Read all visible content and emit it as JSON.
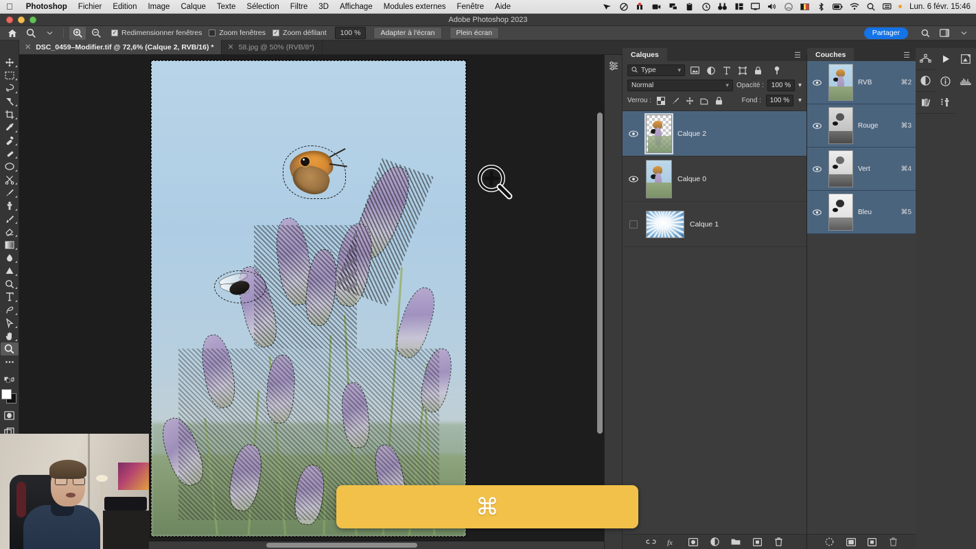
{
  "macbar": {
    "apple_icon": "apple-icon",
    "items": [
      {
        "label": "Photoshop",
        "bold": true
      },
      {
        "label": "Fichier",
        "bold": false
      },
      {
        "label": "Edition",
        "bold": false
      },
      {
        "label": "Image",
        "bold": false
      },
      {
        "label": "Calque",
        "bold": false
      },
      {
        "label": "Texte",
        "bold": false
      },
      {
        "label": "Sélection",
        "bold": false
      },
      {
        "label": "Filtre",
        "bold": false
      },
      {
        "label": "3D",
        "bold": false
      },
      {
        "label": "Affichage",
        "bold": false
      },
      {
        "label": "Modules externes",
        "bold": false
      },
      {
        "label": "Fenêtre",
        "bold": false
      },
      {
        "label": "Aide",
        "bold": false
      }
    ],
    "status_icons": [
      "airplay-icon",
      "shield-icon",
      "alarm-badge-icon",
      "screen-record-icon",
      "transfer-icon",
      "clipboard-icon",
      "clock-icon",
      "binoculars-icon",
      "columns-icon",
      "display-icon",
      "volume-icon",
      "siri-icon",
      "belgium-flag-icon",
      "bluetooth-icon",
      "battery-icon",
      "wifi-icon",
      "search-icon",
      "control-center-icon"
    ],
    "clock": "Lun. 6 févr.  15:46"
  },
  "titlebar": {
    "title": "Adobe Photoshop 2023"
  },
  "options": {
    "home_icon": "home-icon",
    "tool_icon": "zoom-tool-icon",
    "zoom_in_icon": "zoom-in-icon",
    "zoom_out_icon": "zoom-out-icon",
    "checkboxes": [
      {
        "label": "Redimensionner fenêtres",
        "checked": true
      },
      {
        "label": "Zoom fenêtres",
        "checked": false
      },
      {
        "label": "Zoom défilant",
        "checked": true
      }
    ],
    "zoom_value": "100 %",
    "fit_screen_label": "Adapter à l'écran",
    "fullscreen_label": "Plein écran",
    "share_label": "Partager",
    "search_icon": "search-icon",
    "workspace_icon": "workspace-icon",
    "chevron_icon": "chevron-down-icon"
  },
  "tabs": [
    {
      "title": "DSC_0459–Modifier.tif @ 72,6% (Calque 2, RVB/16) *",
      "active": true,
      "close_icon": "close-icon"
    },
    {
      "title": "58.jpg @ 50% (RVB/8*)",
      "active": false,
      "close_icon": "close-icon"
    }
  ],
  "toolbar": {
    "tools": [
      {
        "name": "move-tool",
        "selected": false
      },
      {
        "name": "marquee-tool",
        "selected": false
      },
      {
        "name": "lasso-tool",
        "selected": false
      },
      {
        "name": "magic-wand-tool",
        "selected": false
      },
      {
        "name": "crop-tool",
        "selected": false
      },
      {
        "name": "eyedropper-tool",
        "selected": false
      },
      {
        "name": "healing-brush-tool",
        "selected": false
      },
      {
        "name": "brush-tool",
        "selected": false
      },
      {
        "name": "clone-stamp-tool",
        "selected": false
      },
      {
        "name": "history-brush-tool",
        "selected": false
      },
      {
        "name": "eraser-tool",
        "selected": false
      },
      {
        "name": "gradient-tool",
        "selected": false
      },
      {
        "name": "blur-tool",
        "selected": false
      },
      {
        "name": "dodge-tool",
        "selected": false
      },
      {
        "name": "pen-tool",
        "selected": false
      },
      {
        "name": "type-tool",
        "selected": false
      },
      {
        "name": "path-selection-tool",
        "selected": false
      },
      {
        "name": "shape-tool",
        "selected": false
      },
      {
        "name": "hand-tool",
        "selected": false
      },
      {
        "name": "zoom-tool",
        "selected": true
      },
      {
        "name": "more-tools",
        "selected": false
      }
    ],
    "foreground_color": "#ffffff",
    "background_color": "#111111",
    "quickmask_icon": "quick-mask-icon",
    "screenmode_icon": "screen-mode-icon"
  },
  "canvas": {
    "zoom_cursor_icon": "zoom-in-cursor-icon",
    "document_image": "butterfly-on-lavender-photo",
    "selection_active": true
  },
  "layers_panel": {
    "tab_label": "Calques",
    "menu_icon": "panel-menu-icon",
    "filter_placeholder": "Type",
    "filter_icon": "search-icon",
    "filter_type_icons": [
      "image-filter-icon",
      "adjustment-filter-icon",
      "type-filter-icon",
      "shape-filter-icon",
      "smartobject-filter-icon"
    ],
    "filter_toggle_icon": "filter-toggle-icon",
    "blend_mode": "Normal",
    "opacity_label": "Opacité :",
    "opacity_value": "100 %",
    "lock_label": "Verrou :",
    "lock_icons": [
      "lock-transparency-icon",
      "lock-image-icon",
      "lock-position-icon",
      "lock-artboard-icon",
      "lock-all-icon"
    ],
    "fill_label": "Fond :",
    "fill_value": "100 %",
    "layers": [
      {
        "name": "Calque 2",
        "visible": true,
        "selected": true,
        "thumb": "butterfly-cutout-thumb"
      },
      {
        "name": "Calque 0",
        "visible": true,
        "selected": false,
        "thumb": "butterfly-photo-thumb"
      },
      {
        "name": "Calque 1",
        "visible": false,
        "selected": false,
        "thumb": "clouds-thumb"
      }
    ],
    "footer_icons": [
      "link-layers-icon",
      "layer-style-icon",
      "layer-mask-icon",
      "adjustment-layer-icon",
      "new-group-icon",
      "new-layer-icon",
      "delete-layer-icon"
    ]
  },
  "channels_panel": {
    "tab_label": "Couches",
    "menu_icon": "panel-menu-icon",
    "channels": [
      {
        "name": "RVB",
        "shortcut": "⌘2",
        "visible": true,
        "selected": true,
        "thumb": "rgb-composite-thumb"
      },
      {
        "name": "Rouge",
        "shortcut": "⌘3",
        "visible": true,
        "selected": true,
        "thumb": "red-channel-thumb"
      },
      {
        "name": "Vert",
        "shortcut": "⌘4",
        "visible": true,
        "selected": true,
        "thumb": "green-channel-thumb"
      },
      {
        "name": "Bleu",
        "shortcut": "⌘5",
        "visible": true,
        "selected": true,
        "thumb": "blue-channel-thumb"
      }
    ],
    "footer_icons": [
      "load-selection-icon",
      "save-selection-icon",
      "new-channel-icon",
      "delete-channel-icon"
    ]
  },
  "right_rail": {
    "column_a": [
      "paths-panel-icon",
      "adjustments-panel-icon",
      "libraries-panel-icon"
    ],
    "column_b": [
      "actions-panel-icon",
      "info-panel-icon",
      "clone-source-panel-icon"
    ],
    "column_c": [
      "navigator-panel-icon",
      "histogram-panel-icon"
    ]
  },
  "overlays": {
    "key_overlay_glyph": "⌘",
    "key_overlay_color": "#f2c14a",
    "webcam": "presenter-webcam-feed"
  },
  "colors": {
    "accent_blue": "#1473e6",
    "panel_bg": "#3c3c3c",
    "selection_blue": "#4b647e",
    "canvas_bg": "#1d1d1d"
  }
}
